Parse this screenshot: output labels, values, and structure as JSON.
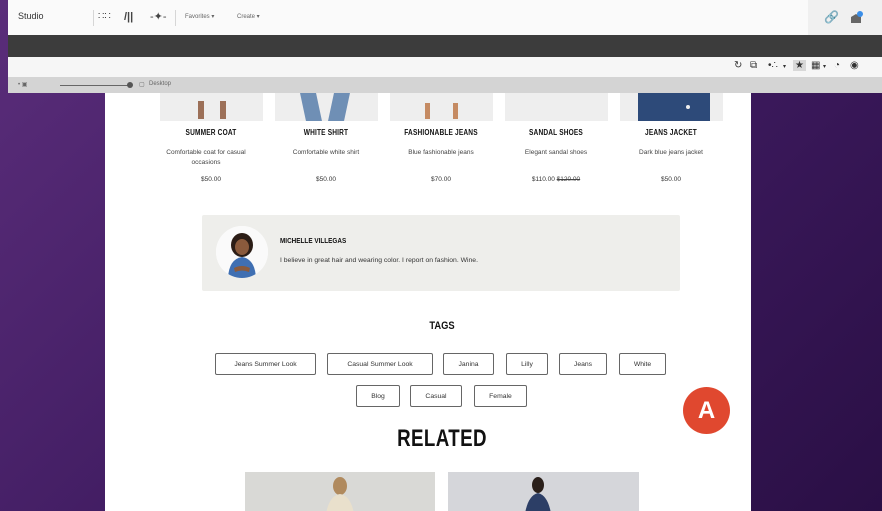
{
  "topbar": {
    "brand": "Studio",
    "menus": [
      "Favorites ▾",
      "Create ▾"
    ]
  },
  "viewbar": {
    "device_label": "Desktop"
  },
  "products": [
    {
      "name": "SUMMER COAT",
      "desc": "Comfortable coat for casual occasions",
      "price": "$50.00",
      "old_price": ""
    },
    {
      "name": "WHITE SHIRT",
      "desc": "Comfortable white shirt",
      "price": "$50.00",
      "old_price": ""
    },
    {
      "name": "FASHIONABLE JEANS",
      "desc": "Blue fashionable jeans",
      "price": "$70.00",
      "old_price": ""
    },
    {
      "name": "SANDAL SHOES",
      "desc": "Elegant sandal shoes",
      "price": "$110.00",
      "old_price": "$120.00"
    },
    {
      "name": "JEANS JACKET",
      "desc": "Dark blue jeans jacket",
      "price": "$50.00",
      "old_price": ""
    }
  ],
  "author": {
    "name": "MICHELLE VILLEGAS",
    "bio": "I believe in great hair and wearing color. I report on fashion. Wine."
  },
  "tags_heading": "TAGS",
  "tags": [
    "Jeans Summer Look",
    "Casual Summer Look",
    "Janina",
    "Lilly",
    "Jeans",
    "White",
    "Blog",
    "Casual",
    "Female"
  ],
  "related_heading": "RELATED",
  "marker": {
    "label": "A",
    "color": "#e0482f"
  },
  "colors": {
    "background": "#4a2368",
    "darkbar": "#3c3c3c",
    "tag_border": "#666666"
  }
}
